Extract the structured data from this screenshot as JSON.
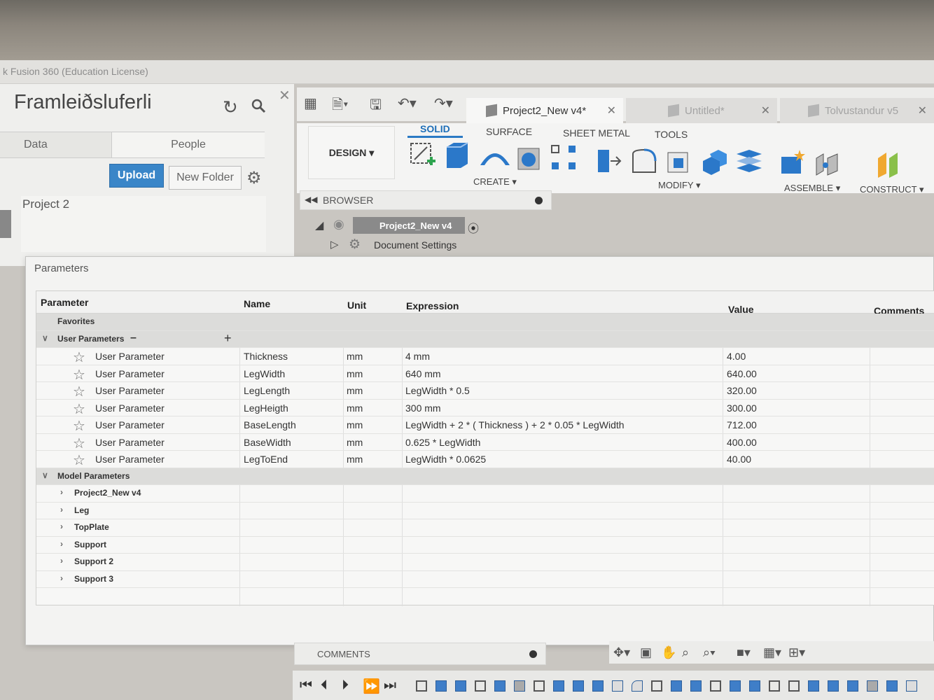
{
  "window": {
    "title": "k Fusion 360 (Education License)"
  },
  "data_panel": {
    "title": "Framleiðsluferli",
    "tabs": [
      "Data",
      "People"
    ],
    "upload_label": "Upload",
    "new_folder_label": "New Folder",
    "project_label": "Project 2"
  },
  "doc_tabs": [
    {
      "label": "Project2_New v4*",
      "active": true
    },
    {
      "label": "Untitled*",
      "active": false
    },
    {
      "label": "Tolvustandur v5",
      "active": false
    }
  ],
  "ribbon": {
    "workspace": "DESIGN",
    "tabs": [
      "SOLID",
      "SURFACE",
      "SHEET METAL",
      "TOOLS"
    ],
    "groups": [
      "CREATE",
      "MODIFY",
      "ASSEMBLE",
      "CONSTRUCT"
    ],
    "accent_color": "#2b7ac4"
  },
  "browser": {
    "title": "BROWSER",
    "root": "Project2_New v4",
    "items": [
      "Document Settings"
    ]
  },
  "parameters": {
    "title": "Parameters",
    "columns": [
      "Parameter",
      "Name",
      "Unit",
      "Expression",
      "Value",
      "Comments"
    ],
    "favorites_label": "Favorites",
    "user_group_label": "User Parameters",
    "user_rows": [
      {
        "type": "User Parameter",
        "name": "Thickness",
        "unit": "mm",
        "expression": "4 mm",
        "value": "4.00"
      },
      {
        "type": "User Parameter",
        "name": "LegWidth",
        "unit": "mm",
        "expression": "640 mm",
        "value": "640.00"
      },
      {
        "type": "User Parameter",
        "name": "LegLength",
        "unit": "mm",
        "expression": "LegWidth * 0.5",
        "value": "320.00"
      },
      {
        "type": "User Parameter",
        "name": "LegHeigth",
        "unit": "mm",
        "expression": "300 mm",
        "value": "300.00"
      },
      {
        "type": "User Parameter",
        "name": "BaseLength",
        "unit": "mm",
        "expression": "LegWidth + 2 * ( Thickness ) + 2 * 0.05 * LegWidth",
        "value": "712.00"
      },
      {
        "type": "User Parameter",
        "name": "BaseWidth",
        "unit": "mm",
        "expression": "0.625 * LegWidth",
        "value": "400.00"
      },
      {
        "type": "User Parameter",
        "name": "LegToEnd",
        "unit": "mm",
        "expression": "LegWidth * 0.0625",
        "value": "40.00"
      }
    ],
    "model_group_label": "Model Parameters",
    "model_items": [
      "Project2_New v4",
      "Leg",
      "TopPlate",
      "Support",
      "Support 2",
      "Support 3"
    ]
  },
  "comments_label": "COMMENTS"
}
